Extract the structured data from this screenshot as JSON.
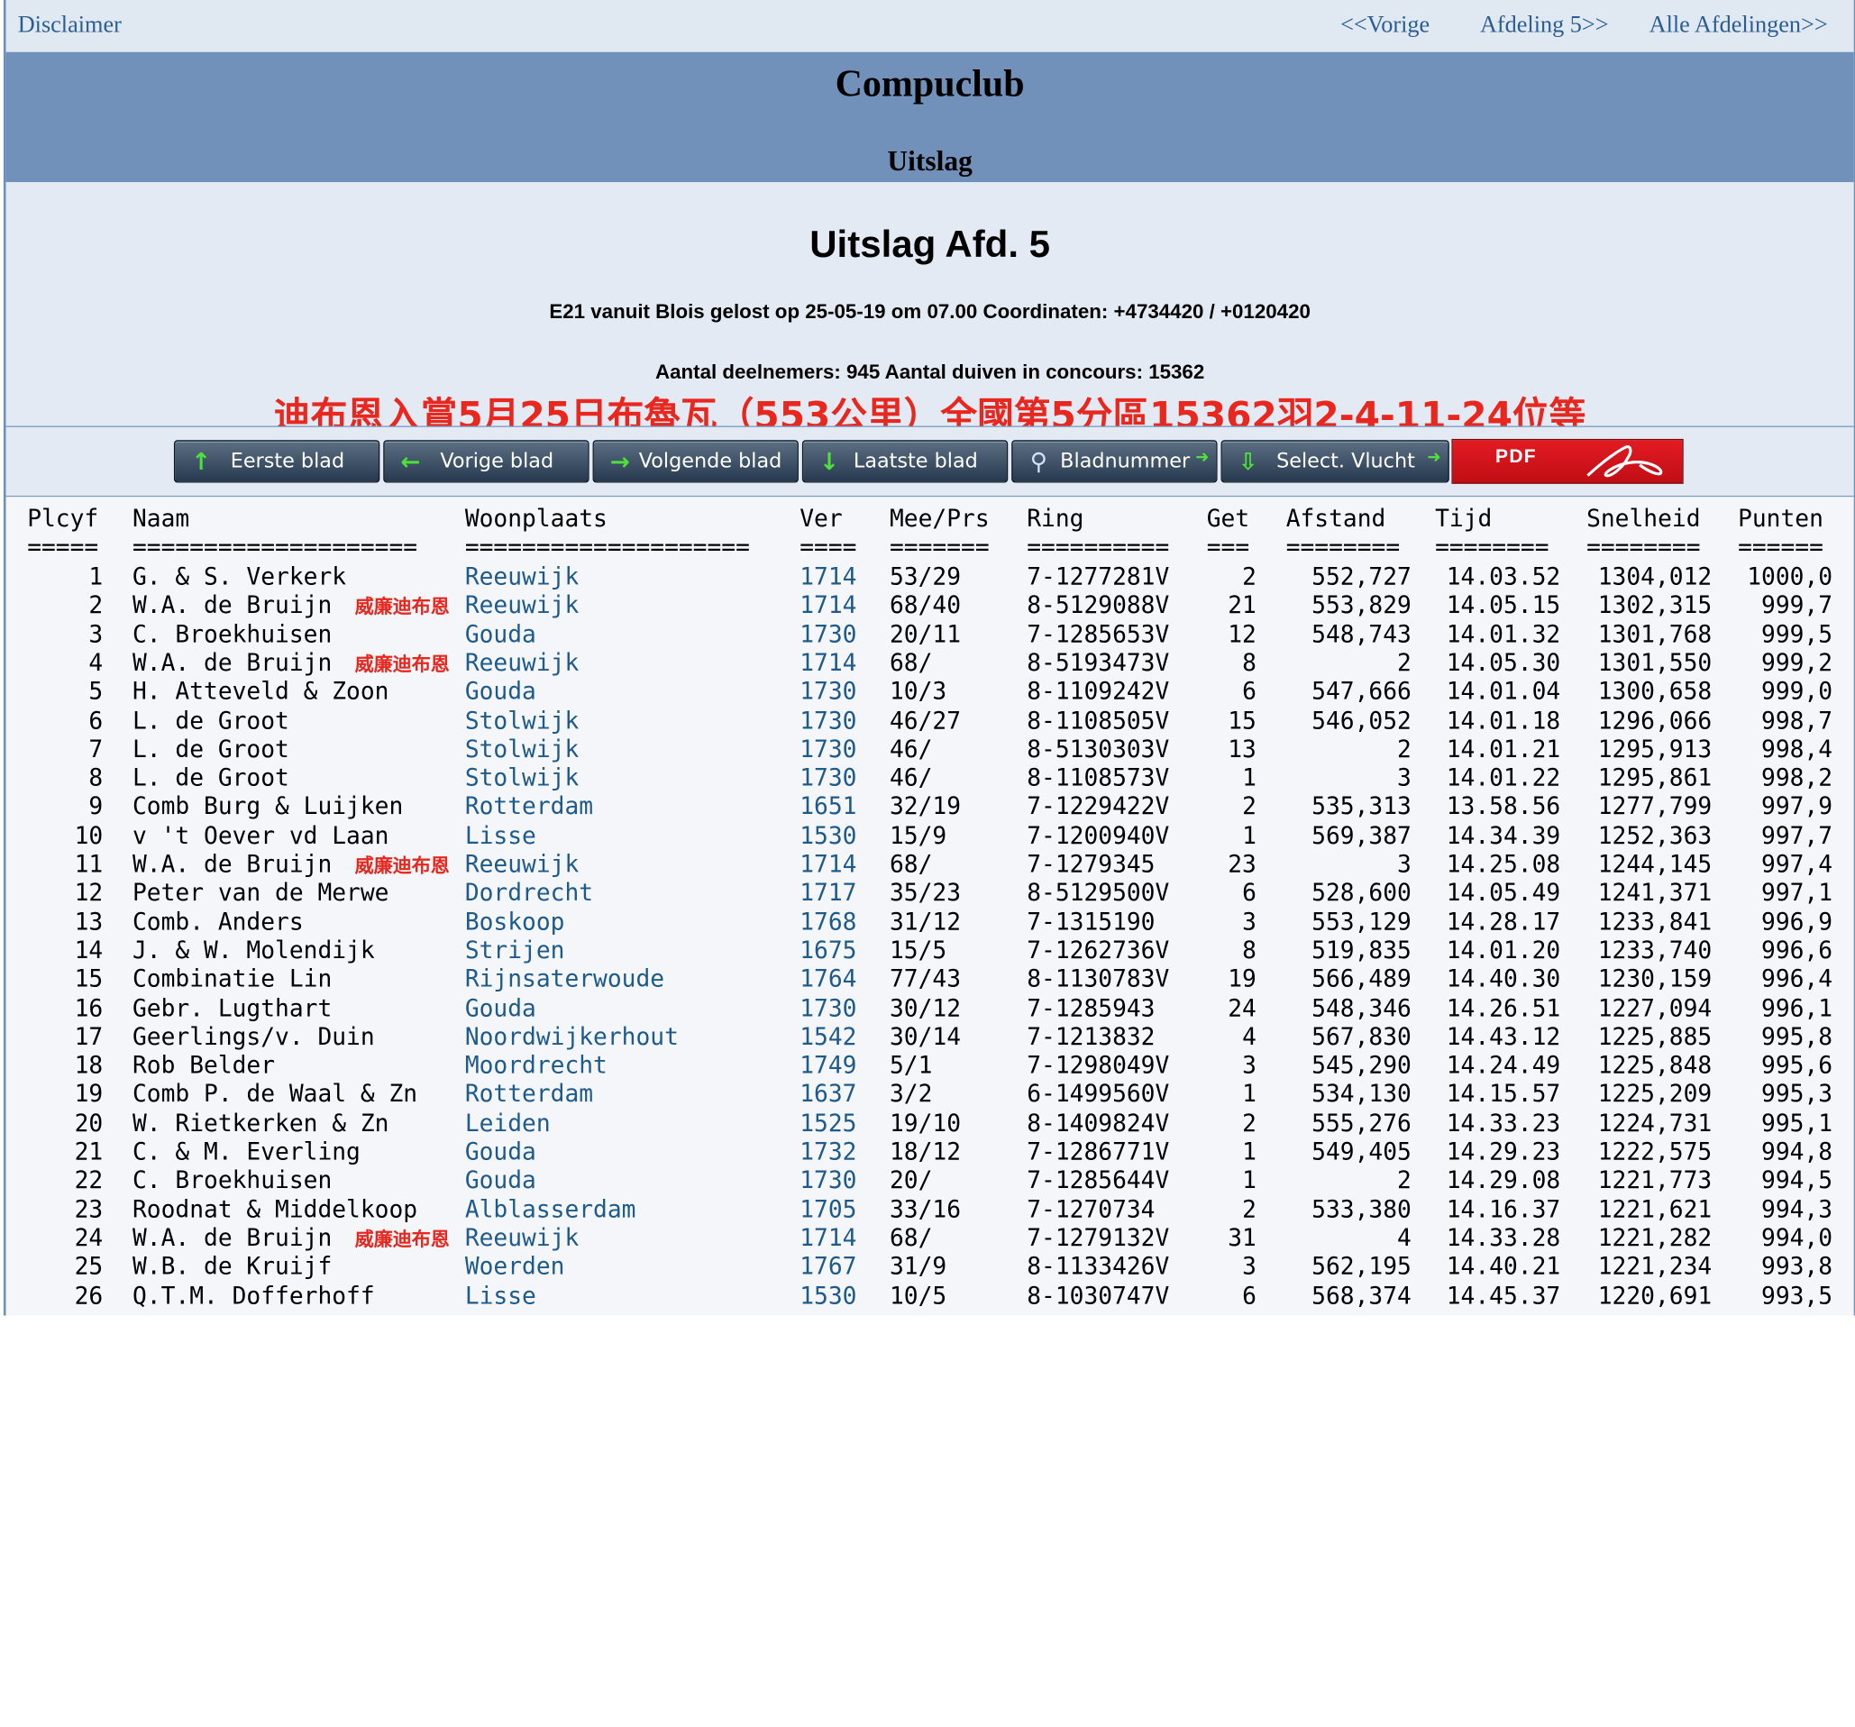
{
  "topnav": {
    "disclaimer": "Disclaimer",
    "prev": "<<Vorige",
    "next": "Afdeling 5>>",
    "all": "Alle Afdelingen>>"
  },
  "banner": {
    "title": "Compuclub",
    "subtitle": "Uitslag"
  },
  "result": {
    "heading": "Uitslag Afd. 5",
    "flight_info": "E21 vanuit Blois gelost op 25-05-19 om 07.00 Coordinaten: +4734420 / +0120420",
    "counts": "Aantal deelnemers: 945 Aantal duiven in concours: 15362",
    "overlay_note": "迪布恩入賞5月25日布魯瓦（553公里）全國第5分區15362羽2-4-11-24位等"
  },
  "nav_buttons": [
    {
      "label": "Eerste blad",
      "icon": "arrow-up-icon"
    },
    {
      "label": "Vorige blad",
      "icon": "arrow-left-icon"
    },
    {
      "label": "Volgende blad",
      "icon": "arrow-right-icon"
    },
    {
      "label": "Laatste blad",
      "icon": "arrow-down-icon"
    },
    {
      "label": "Bladnummer",
      "icon": "magnifier-icon"
    },
    {
      "label": "Select. Vlucht",
      "icon": "download-icon"
    }
  ],
  "pdf_button": {
    "label": "PDF",
    "icon": "acrobat-icon"
  },
  "colors": {
    "banner": "#7191bb",
    "link": "#2a5d93",
    "overlay_red": "#e8271f",
    "pdf_red": "#e31b22"
  },
  "table": {
    "headers": [
      "Plcyf",
      "Naam",
      "Woonplaats",
      "Ver",
      "Mee/Prs",
      "Ring",
      "Get",
      "Afstand",
      "Tijd",
      "Snelheid",
      "Punten"
    ],
    "underlines": [
      "=====",
      "====================",
      "====================",
      "====",
      "=======",
      "==========",
      "===",
      "========",
      "========",
      "========",
      "======"
    ],
    "rows": [
      [
        "1",
        "G. & S. Verkerk",
        "Reeuwijk",
        "1714",
        "53/29",
        "7-1277281V",
        "2",
        "552,727",
        "14.03.52",
        "1304,012",
        "1000,0",
        ""
      ],
      [
        "2",
        "W.A. de Bruijn",
        "Reeuwijk",
        "1714",
        "68/40",
        "8-5129088V",
        "21",
        "553,829",
        "14.05.15",
        "1302,315",
        "999,7",
        "威廉迪布恩"
      ],
      [
        "3",
        "C. Broekhuisen",
        "Gouda",
        "1730",
        "20/11",
        "7-1285653V",
        "12",
        "548,743",
        "14.01.32",
        "1301,768",
        "999,5",
        ""
      ],
      [
        "4",
        "W.A. de Bruijn",
        "Reeuwijk",
        "1714",
        "68/",
        "8-5193473V",
        "8",
        "2",
        "14.05.30",
        "1301,550",
        "999,2",
        "威廉迪布恩"
      ],
      [
        "5",
        "H. Atteveld & Zoon",
        "Gouda",
        "1730",
        "10/3",
        "8-1109242V",
        "6",
        "547,666",
        "14.01.04",
        "1300,658",
        "999,0",
        ""
      ],
      [
        "6",
        "L. de Groot",
        "Stolwijk",
        "1730",
        "46/27",
        "8-1108505V",
        "15",
        "546,052",
        "14.01.18",
        "1296,066",
        "998,7",
        ""
      ],
      [
        "7",
        "L. de Groot",
        "Stolwijk",
        "1730",
        "46/",
        "8-5130303V",
        "13",
        "2",
        "14.01.21",
        "1295,913",
        "998,4",
        ""
      ],
      [
        "8",
        "L. de Groot",
        "Stolwijk",
        "1730",
        "46/",
        "8-1108573V",
        "1",
        "3",
        "14.01.22",
        "1295,861",
        "998,2",
        ""
      ],
      [
        "9",
        "Comb Burg & Luijken",
        "Rotterdam",
        "1651",
        "32/19",
        "7-1229422V",
        "2",
        "535,313",
        "13.58.56",
        "1277,799",
        "997,9",
        ""
      ],
      [
        "10",
        "v 't Oever vd Laan",
        "Lisse",
        "1530",
        "15/9",
        "7-1200940V",
        "1",
        "569,387",
        "14.34.39",
        "1252,363",
        "997,7",
        ""
      ],
      [
        "11",
        "W.A. de Bruijn",
        "Reeuwijk",
        "1714",
        "68/",
        "7-1279345",
        "23",
        "3",
        "14.25.08",
        "1244,145",
        "997,4",
        "威廉迪布恩"
      ],
      [
        "12",
        "Peter van de Merwe",
        "Dordrecht",
        "1717",
        "35/23",
        "8-5129500V",
        "6",
        "528,600",
        "14.05.49",
        "1241,371",
        "997,1",
        ""
      ],
      [
        "13",
        "Comb. Anders",
        "Boskoop",
        "1768",
        "31/12",
        "7-1315190",
        "3",
        "553,129",
        "14.28.17",
        "1233,841",
        "996,9",
        ""
      ],
      [
        "14",
        "J. & W. Molendijk",
        "Strijen",
        "1675",
        "15/5",
        "7-1262736V",
        "8",
        "519,835",
        "14.01.20",
        "1233,740",
        "996,6",
        ""
      ],
      [
        "15",
        "Combinatie Lin",
        "Rijnsaterwoude",
        "1764",
        "77/43",
        "8-1130783V",
        "19",
        "566,489",
        "14.40.30",
        "1230,159",
        "996,4",
        ""
      ],
      [
        "16",
        "Gebr. Lugthart",
        "Gouda",
        "1730",
        "30/12",
        "7-1285943",
        "24",
        "548,346",
        "14.26.51",
        "1227,094",
        "996,1",
        ""
      ],
      [
        "17",
        "Geerlings/v. Duin",
        "Noordwijkerhout",
        "1542",
        "30/14",
        "7-1213832",
        "4",
        "567,830",
        "14.43.12",
        "1225,885",
        "995,8",
        ""
      ],
      [
        "18",
        "Rob Belder",
        "Moordrecht",
        "1749",
        "5/1",
        "7-1298049V",
        "3",
        "545,290",
        "14.24.49",
        "1225,848",
        "995,6",
        ""
      ],
      [
        "19",
        "Comb P. de Waal & Zn",
        "Rotterdam",
        "1637",
        "3/2",
        "6-1499560V",
        "1",
        "534,130",
        "14.15.57",
        "1225,209",
        "995,3",
        ""
      ],
      [
        "20",
        "W. Rietkerken & Zn",
        "Leiden",
        "1525",
        "19/10",
        "8-1409824V",
        "2",
        "555,276",
        "14.33.23",
        "1224,731",
        "995,1",
        ""
      ],
      [
        "21",
        "C. & M. Everling",
        "Gouda",
        "1732",
        "18/12",
        "7-1286771V",
        "1",
        "549,405",
        "14.29.23",
        "1222,575",
        "994,8",
        ""
      ],
      [
        "22",
        "C. Broekhuisen",
        "Gouda",
        "1730",
        "20/",
        "7-1285644V",
        "1",
        "2",
        "14.29.08",
        "1221,773",
        "994,5",
        ""
      ],
      [
        "23",
        "Roodnat & Middelkoop",
        "Alblasserdam",
        "1705",
        "33/16",
        "7-1270734",
        "2",
        "533,380",
        "14.16.37",
        "1221,621",
        "994,3",
        ""
      ],
      [
        "24",
        "W.A. de Bruijn",
        "Reeuwijk",
        "1714",
        "68/",
        "7-1279132V",
        "31",
        "4",
        "14.33.28",
        "1221,282",
        "994,0",
        "威廉迪布恩"
      ],
      [
        "25",
        "W.B. de Kruijf",
        "Woerden",
        "1767",
        "31/9",
        "8-1133426V",
        "3",
        "562,195",
        "14.40.21",
        "1221,234",
        "993,8",
        ""
      ],
      [
        "26",
        "Q.T.M. Dofferhoff",
        "Lisse",
        "1530",
        "10/5",
        "8-1030747V",
        "6",
        "568,374",
        "14.45.37",
        "1220,691",
        "993,5",
        ""
      ]
    ]
  }
}
